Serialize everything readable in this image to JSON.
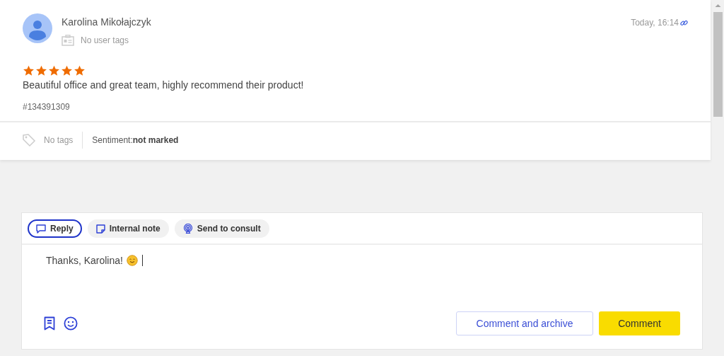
{
  "review": {
    "author": "Karolina Mikołajczyk",
    "user_tags": "No user tags",
    "time": "Today, 16:14",
    "stars": 5,
    "text": "Beautiful office and great team, highly recommend their product!",
    "id": "#134391309",
    "tags": "No tags",
    "sentiment_label": "Sentiment:",
    "sentiment_value": "not marked"
  },
  "composer": {
    "tabs": [
      {
        "label": "Reply",
        "kind": "reply",
        "selected": true
      },
      {
        "label": "Internal note",
        "kind": "note",
        "selected": false
      },
      {
        "label": "Send to consult",
        "kind": "consult",
        "selected": false
      }
    ],
    "value": "Thanks, Karolina!",
    "buttons": [
      {
        "label": "Comment and archive",
        "kind": "secondary"
      },
      {
        "label": "Comment",
        "kind": "primary"
      }
    ]
  }
}
